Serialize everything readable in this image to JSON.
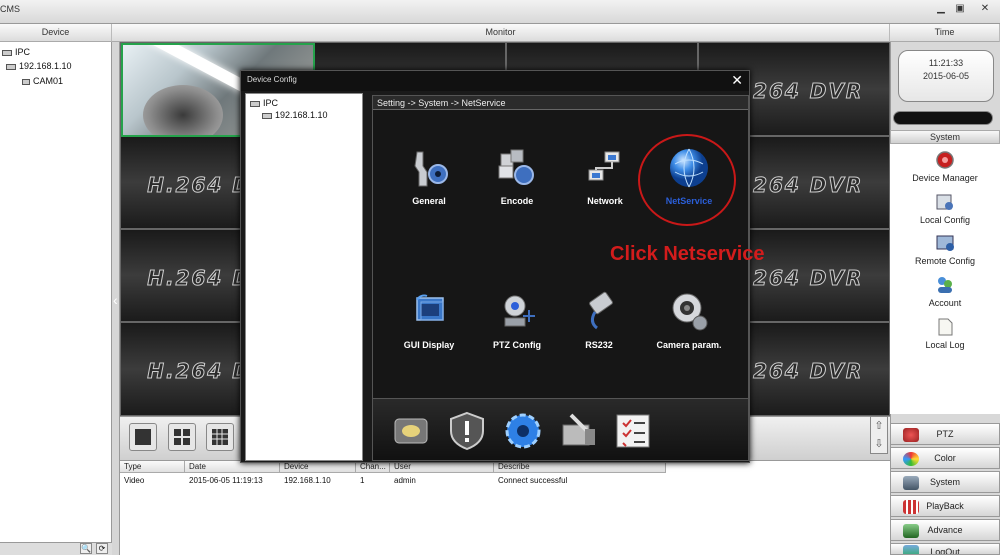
{
  "app": {
    "title": "CMS"
  },
  "window_controls": {
    "minimize": "▁",
    "restore": "▣",
    "close": "✕"
  },
  "headers": {
    "device": "Device",
    "monitor": "Monitor",
    "time": "Time"
  },
  "device_tree": {
    "root": "IPC",
    "device": "192.168.1.10",
    "camera": "CAM01"
  },
  "device_bottom": {
    "btn1": "🔍",
    "btn2": "⟳"
  },
  "monitor": {
    "cell_label": "H.264 DVR",
    "scroll_up": "⇧",
    "scroll_down": "⇩"
  },
  "log": {
    "columns": [
      "Type",
      "Date",
      "Device",
      "Chan...",
      "User",
      "Describe"
    ],
    "rows": [
      [
        "Video",
        "2015-06-05 11:19:13",
        "192.168.1.10",
        "1",
        "admin",
        "Connect successful"
      ]
    ]
  },
  "clock": {
    "time": "11:21:33",
    "date": "2015-06-05"
  },
  "right_panel": {
    "section_title": "System",
    "items": [
      {
        "label": "Device Manager",
        "icon": "device-manager-icon"
      },
      {
        "label": "Local Config",
        "icon": "local-config-icon"
      },
      {
        "label": "Remote Config",
        "icon": "remote-config-icon"
      },
      {
        "label": "Account",
        "icon": "account-icon"
      },
      {
        "label": "Local Log",
        "icon": "local-log-icon"
      }
    ],
    "nav": [
      {
        "label": "PTZ",
        "icon": "ptz-icon"
      },
      {
        "label": "Color",
        "icon": "color-icon"
      },
      {
        "label": "System",
        "icon": "system-icon"
      },
      {
        "label": "PlayBack",
        "icon": "playback-icon"
      },
      {
        "label": "Advance",
        "icon": "advance-icon"
      },
      {
        "label": "LogOut",
        "icon": "logout-icon"
      }
    ]
  },
  "dialog": {
    "title": "Device Config",
    "close": "✕",
    "tree": {
      "root": "IPC",
      "device": "192.168.1.10"
    },
    "breadcrumb": "Setting -> System -> NetService",
    "items": [
      {
        "label": "General",
        "icon": "general-icon"
      },
      {
        "label": "Encode",
        "icon": "encode-icon"
      },
      {
        "label": "Network",
        "icon": "network-icon"
      },
      {
        "label": "NetService",
        "icon": "netservice-icon",
        "highlight_color": "#2b5fd9"
      },
      {
        "label": "GUI Display",
        "icon": "gui-display-icon"
      },
      {
        "label": "PTZ Config",
        "icon": "ptz-config-icon"
      },
      {
        "label": "RS232",
        "icon": "rs232-icon"
      },
      {
        "label": "Camera param.",
        "icon": "camera-param-icon"
      }
    ],
    "callout": "Click Netservice",
    "tabs": [
      "record-icon",
      "alarm-icon",
      "system-gear-icon",
      "tools-icon",
      "info-icon"
    ]
  },
  "colors": {
    "accent_red": "#d31c1c",
    "selection_green": "#25a24b",
    "netservice_blue": "#2b5fd9"
  }
}
